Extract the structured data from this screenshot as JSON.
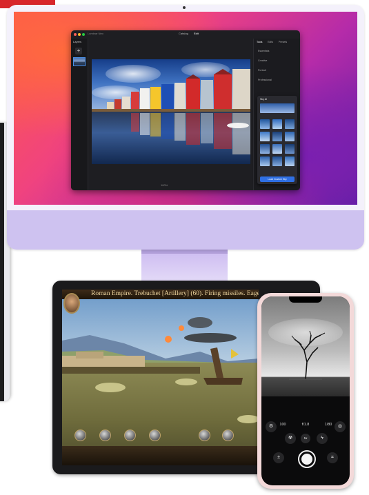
{
  "mac_app": {
    "window_title": "Luminar Neo",
    "tab_catalog": "Catalog",
    "tab_edit": "Edit",
    "sidebar_label": "Layers",
    "add_layer": "+",
    "right_panel_tabs": [
      "Tools",
      "Edits",
      "Presets"
    ],
    "right_panel_items": [
      "Essentials",
      "Creative",
      "Portrait",
      "Professional"
    ],
    "sky_popup_title": "Sky AI",
    "sky_button": "Load Custom Sky",
    "bottom_toolbar": "100%"
  },
  "game": {
    "header_text": "Roman Empire.  Trebuchet [Artillery] (60).  Firing missiles.  Eager"
  },
  "camera": {
    "iso": "100",
    "aperture": "f/1.8",
    "shutter": "1/80",
    "zoom": "1x"
  },
  "colors": {
    "accent_red": "#d8262a",
    "imac_purple": "#cec2f0",
    "app_blue": "#2f6fe4",
    "iphone_pink": "#f3d9d9"
  }
}
